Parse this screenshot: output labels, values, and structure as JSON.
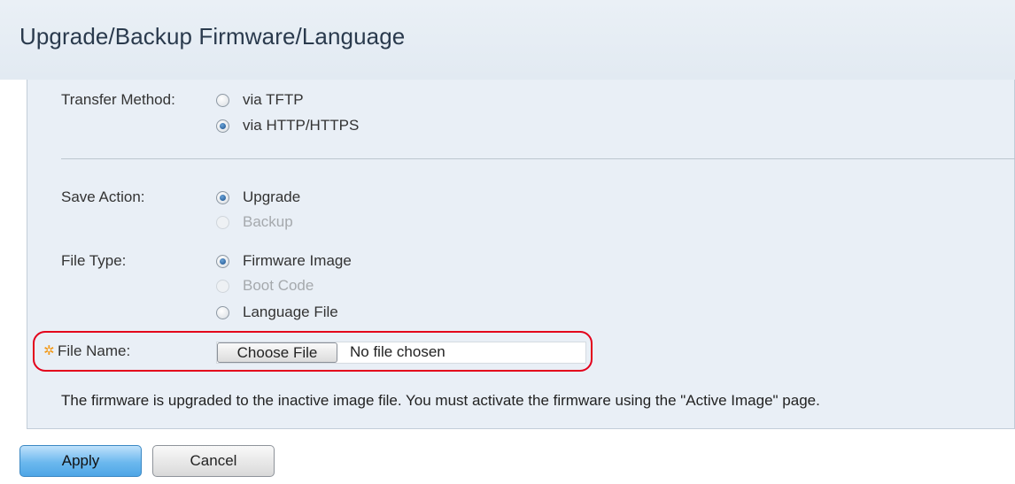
{
  "page": {
    "title": "Upgrade/Backup Firmware/Language"
  },
  "transfer_method": {
    "label": "Transfer Method:",
    "options": [
      {
        "label": "via TFTP",
        "checked": false,
        "disabled": false
      },
      {
        "label": "via HTTP/HTTPS",
        "checked": true,
        "disabled": false
      }
    ]
  },
  "save_action": {
    "label": "Save Action:",
    "options": [
      {
        "label": "Upgrade",
        "checked": true,
        "disabled": false
      },
      {
        "label": "Backup",
        "checked": false,
        "disabled": true
      }
    ]
  },
  "file_type": {
    "label": "File Type:",
    "options": [
      {
        "label": "Firmware Image",
        "checked": true,
        "disabled": false
      },
      {
        "label": "Boot Code",
        "checked": false,
        "disabled": true
      },
      {
        "label": "Language File",
        "checked": false,
        "disabled": false
      }
    ]
  },
  "file_name": {
    "label": "File Name:",
    "required_icon": "asterisk-gear-icon",
    "choose_button": "Choose File",
    "status": "No file chosen"
  },
  "note": "The firmware is upgraded to the inactive image file. You must activate the firmware using the \"Active Image\" page.",
  "buttons": {
    "apply": "Apply",
    "cancel": "Cancel"
  },
  "colors": {
    "highlight": "#e3001b",
    "required": "#f29a1a",
    "apply": "#6cb8ee"
  }
}
